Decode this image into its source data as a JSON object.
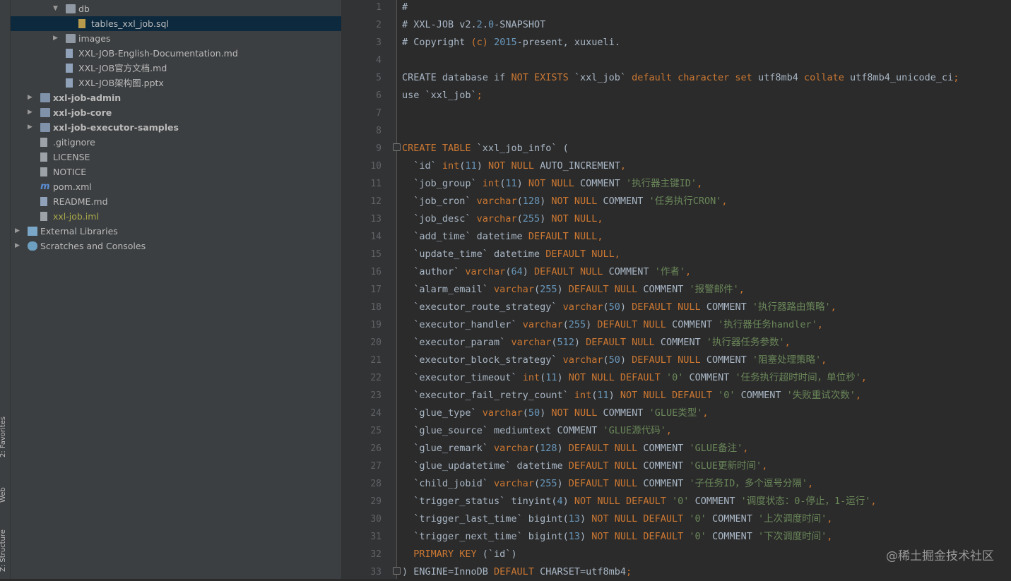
{
  "side_strip": {
    "favorites": "2: Favorites",
    "web": "Web",
    "structure": "Z: Structure"
  },
  "tree": [
    {
      "label": "db",
      "level": 3,
      "arrow": "▼",
      "icon": "folder-icon"
    },
    {
      "label": "tables_xxl_job.sql",
      "level": 4,
      "arrow": "",
      "icon": "sql-file-icon",
      "selected": true
    },
    {
      "label": "images",
      "level": 3,
      "arrow": "▶",
      "icon": "folder-icon"
    },
    {
      "label": "XXL-JOB-English-Documentation.md",
      "level": 3,
      "arrow": "",
      "icon": "markdown-file-icon"
    },
    {
      "label": "XXL-JOB官方文档.md",
      "level": 3,
      "arrow": "",
      "icon": "markdown-file-icon"
    },
    {
      "label": "XXL-JOB架构图.pptx",
      "level": 3,
      "arrow": "",
      "icon": "pptx-file-icon"
    },
    {
      "label": "xxl-job-admin",
      "level": 1,
      "arrow": "▶",
      "icon": "module-folder-icon",
      "bold": true
    },
    {
      "label": "xxl-job-core",
      "level": 1,
      "arrow": "▶",
      "icon": "module-folder-icon",
      "bold": true
    },
    {
      "label": "xxl-job-executor-samples",
      "level": 1,
      "arrow": "▶",
      "icon": "module-folder-icon",
      "bold": true
    },
    {
      "label": ".gitignore",
      "level": 1,
      "arrow": "",
      "icon": "text-file-icon"
    },
    {
      "label": "LICENSE",
      "level": 1,
      "arrow": "",
      "icon": "text-file-icon"
    },
    {
      "label": "NOTICE",
      "level": 1,
      "arrow": "",
      "icon": "text-file-icon"
    },
    {
      "label": "pom.xml",
      "level": 1,
      "arrow": "",
      "icon": "maven-icon"
    },
    {
      "label": "README.md",
      "level": 1,
      "arrow": "",
      "icon": "markdown-file-icon"
    },
    {
      "label": "xxl-job.iml",
      "level": 1,
      "arrow": "",
      "icon": "iml-file-icon",
      "olive": true
    },
    {
      "label": "External Libraries",
      "level": 0,
      "arrow": "▶",
      "icon": "library-icon"
    },
    {
      "label": "Scratches and Consoles",
      "level": 0,
      "arrow": "▶",
      "icon": "scratches-icon"
    }
  ],
  "editor": {
    "line_numbers": [
      "1",
      "2",
      "3",
      "4",
      "5",
      "6",
      "7",
      "8",
      "9",
      "10",
      "11",
      "12",
      "13",
      "14",
      "15",
      "16",
      "17",
      "18",
      "19",
      "20",
      "21",
      "22",
      "23",
      "24",
      "25",
      "26",
      "27",
      "28",
      "29",
      "30",
      "31",
      "32",
      "33"
    ],
    "lines": [
      [
        [
          "cmt",
          "#"
        ]
      ],
      [
        [
          "cmt",
          "# XXL-JOB v2."
        ],
        [
          "num",
          "2"
        ],
        [
          "cmt",
          "."
        ],
        [
          "num",
          "0"
        ],
        [
          "cmt",
          "-SNAPSHOT"
        ]
      ],
      [
        [
          "cmt",
          "# Copyright "
        ],
        [
          "kw",
          "(c)"
        ],
        [
          "cmt",
          " "
        ],
        [
          "num",
          "2015"
        ],
        [
          "cmt",
          "-present, xuxueli."
        ]
      ],
      [],
      [
        [
          "bq",
          "CREATE database if "
        ],
        [
          "kw",
          "NOT EXISTS"
        ],
        [
          "bq",
          " `xxl_job` "
        ],
        [
          "kw",
          "default character set"
        ],
        [
          "bq",
          " utf8mb4 "
        ],
        [
          "kw",
          "collate"
        ],
        [
          "bq",
          " utf8mb4_unicode_ci"
        ],
        [
          "kw",
          ";"
        ]
      ],
      [
        [
          "bq",
          "use `xxl_job`"
        ],
        [
          "kw",
          ";"
        ]
      ],
      [],
      [],
      [
        [
          "kw",
          "CREATE TABLE"
        ],
        [
          "bq",
          " `xxl_job_info` ("
        ]
      ],
      [
        [
          "bq",
          "  `id` "
        ],
        [
          "kw",
          "int"
        ],
        [
          "bq",
          "("
        ],
        [
          "num",
          "11"
        ],
        [
          "bq",
          ") "
        ],
        [
          "kw",
          "NOT NULL"
        ],
        [
          "bq",
          " AUTO_INCREMENT"
        ],
        [
          "kw",
          ","
        ]
      ],
      [
        [
          "bq",
          "  `job_group` "
        ],
        [
          "kw",
          "int"
        ],
        [
          "bq",
          "("
        ],
        [
          "num",
          "11"
        ],
        [
          "bq",
          ") "
        ],
        [
          "kw",
          "NOT NULL"
        ],
        [
          "bq",
          " COMMENT "
        ],
        [
          "str",
          "'执行器主键ID'"
        ],
        [
          "kw",
          ","
        ]
      ],
      [
        [
          "bq",
          "  `job_cron` "
        ],
        [
          "kw",
          "varchar"
        ],
        [
          "bq",
          "("
        ],
        [
          "num",
          "128"
        ],
        [
          "bq",
          ") "
        ],
        [
          "kw",
          "NOT NULL"
        ],
        [
          "bq",
          " COMMENT "
        ],
        [
          "str",
          "'任务执行CRON'"
        ],
        [
          "kw",
          ","
        ]
      ],
      [
        [
          "bq",
          "  `job_desc` "
        ],
        [
          "kw",
          "varchar"
        ],
        [
          "bq",
          "("
        ],
        [
          "num",
          "255"
        ],
        [
          "bq",
          ") "
        ],
        [
          "kw",
          "NOT NULL"
        ],
        [
          "kw",
          ","
        ]
      ],
      [
        [
          "bq",
          "  `add_time` datetime "
        ],
        [
          "kw",
          "DEFAULT NULL"
        ],
        [
          "kw",
          ","
        ]
      ],
      [
        [
          "bq",
          "  `update_time` datetime "
        ],
        [
          "kw",
          "DEFAULT NULL"
        ],
        [
          "kw",
          ","
        ]
      ],
      [
        [
          "bq",
          "  `author` "
        ],
        [
          "kw",
          "varchar"
        ],
        [
          "bq",
          "("
        ],
        [
          "num",
          "64"
        ],
        [
          "bq",
          ") "
        ],
        [
          "kw",
          "DEFAULT NULL"
        ],
        [
          "bq",
          " COMMENT "
        ],
        [
          "str",
          "'作者'"
        ],
        [
          "kw",
          ","
        ]
      ],
      [
        [
          "bq",
          "  `alarm_email` "
        ],
        [
          "kw",
          "varchar"
        ],
        [
          "bq",
          "("
        ],
        [
          "num",
          "255"
        ],
        [
          "bq",
          ") "
        ],
        [
          "kw",
          "DEFAULT NULL"
        ],
        [
          "bq",
          " COMMENT "
        ],
        [
          "str",
          "'报警邮件'"
        ],
        [
          "kw",
          ","
        ]
      ],
      [
        [
          "bq",
          "  `executor_route_strategy` "
        ],
        [
          "kw",
          "varchar"
        ],
        [
          "bq",
          "("
        ],
        [
          "num",
          "50"
        ],
        [
          "bq",
          ") "
        ],
        [
          "kw",
          "DEFAULT NULL"
        ],
        [
          "bq",
          " COMMENT "
        ],
        [
          "str",
          "'执行器路由策略'"
        ],
        [
          "kw",
          ","
        ]
      ],
      [
        [
          "bq",
          "  `executor_handler` "
        ],
        [
          "kw",
          "varchar"
        ],
        [
          "bq",
          "("
        ],
        [
          "num",
          "255"
        ],
        [
          "bq",
          ") "
        ],
        [
          "kw",
          "DEFAULT NULL"
        ],
        [
          "bq",
          " COMMENT "
        ],
        [
          "str",
          "'执行器任务handler'"
        ],
        [
          "kw",
          ","
        ]
      ],
      [
        [
          "bq",
          "  `executor_param` "
        ],
        [
          "kw",
          "varchar"
        ],
        [
          "bq",
          "("
        ],
        [
          "num",
          "512"
        ],
        [
          "bq",
          ") "
        ],
        [
          "kw",
          "DEFAULT NULL"
        ],
        [
          "bq",
          " COMMENT "
        ],
        [
          "str",
          "'执行器任务参数'"
        ],
        [
          "kw",
          ","
        ]
      ],
      [
        [
          "bq",
          "  `executor_block_strategy` "
        ],
        [
          "kw",
          "varchar"
        ],
        [
          "bq",
          "("
        ],
        [
          "num",
          "50"
        ],
        [
          "bq",
          ") "
        ],
        [
          "kw",
          "DEFAULT NULL"
        ],
        [
          "bq",
          " COMMENT "
        ],
        [
          "str",
          "'阻塞处理策略'"
        ],
        [
          "kw",
          ","
        ]
      ],
      [
        [
          "bq",
          "  `executor_timeout` "
        ],
        [
          "kw",
          "int"
        ],
        [
          "bq",
          "("
        ],
        [
          "num",
          "11"
        ],
        [
          "bq",
          ") "
        ],
        [
          "kw",
          "NOT NULL DEFAULT"
        ],
        [
          "bq",
          " "
        ],
        [
          "str",
          "'0'"
        ],
        [
          "bq",
          " COMMENT "
        ],
        [
          "str",
          "'任务执行超时时间，单位秒'"
        ],
        [
          "kw",
          ","
        ]
      ],
      [
        [
          "bq",
          "  `executor_fail_retry_count` "
        ],
        [
          "kw",
          "int"
        ],
        [
          "bq",
          "("
        ],
        [
          "num",
          "11"
        ],
        [
          "bq",
          ") "
        ],
        [
          "kw",
          "NOT NULL DEFAULT"
        ],
        [
          "bq",
          " "
        ],
        [
          "str",
          "'0'"
        ],
        [
          "bq",
          " COMMENT "
        ],
        [
          "str",
          "'失败重试次数'"
        ],
        [
          "kw",
          ","
        ]
      ],
      [
        [
          "bq",
          "  `glue_type` "
        ],
        [
          "kw",
          "varchar"
        ],
        [
          "bq",
          "("
        ],
        [
          "num",
          "50"
        ],
        [
          "bq",
          ") "
        ],
        [
          "kw",
          "NOT NULL"
        ],
        [
          "bq",
          " COMMENT "
        ],
        [
          "str",
          "'GLUE类型'"
        ],
        [
          "kw",
          ","
        ]
      ],
      [
        [
          "bq",
          "  `glue_source` mediumtext COMMENT "
        ],
        [
          "str",
          "'GLUE源代码'"
        ],
        [
          "kw",
          ","
        ]
      ],
      [
        [
          "bq",
          "  `glue_remark` "
        ],
        [
          "kw",
          "varchar"
        ],
        [
          "bq",
          "("
        ],
        [
          "num",
          "128"
        ],
        [
          "bq",
          ") "
        ],
        [
          "kw",
          "DEFAULT NULL"
        ],
        [
          "bq",
          " COMMENT "
        ],
        [
          "str",
          "'GLUE备注'"
        ],
        [
          "kw",
          ","
        ]
      ],
      [
        [
          "bq",
          "  `glue_updatetime` datetime "
        ],
        [
          "kw",
          "DEFAULT NULL"
        ],
        [
          "bq",
          " COMMENT "
        ],
        [
          "str",
          "'GLUE更新时间'"
        ],
        [
          "kw",
          ","
        ]
      ],
      [
        [
          "bq",
          "  `child_jobid` "
        ],
        [
          "kw",
          "varchar"
        ],
        [
          "bq",
          "("
        ],
        [
          "num",
          "255"
        ],
        [
          "bq",
          ") "
        ],
        [
          "kw",
          "DEFAULT NULL"
        ],
        [
          "bq",
          " COMMENT "
        ],
        [
          "str",
          "'子任务ID，多个逗号分隔'"
        ],
        [
          "kw",
          ","
        ]
      ],
      [
        [
          "bq",
          "  `trigger_status` tinyint("
        ],
        [
          "num",
          "4"
        ],
        [
          "bq",
          ") "
        ],
        [
          "kw",
          "NOT NULL DEFAULT"
        ],
        [
          "bq",
          " "
        ],
        [
          "str",
          "'0'"
        ],
        [
          "bq",
          " COMMENT "
        ],
        [
          "str",
          "'调度状态：0-停止，1-运行'"
        ],
        [
          "kw",
          ","
        ]
      ],
      [
        [
          "bq",
          "  `trigger_last_time` bigint("
        ],
        [
          "num",
          "13"
        ],
        [
          "bq",
          ") "
        ],
        [
          "kw",
          "NOT NULL DEFAULT"
        ],
        [
          "bq",
          " "
        ],
        [
          "str",
          "'0'"
        ],
        [
          "bq",
          " COMMENT "
        ],
        [
          "str",
          "'上次调度时间'"
        ],
        [
          "kw",
          ","
        ]
      ],
      [
        [
          "bq",
          "  `trigger_next_time` bigint("
        ],
        [
          "num",
          "13"
        ],
        [
          "bq",
          ") "
        ],
        [
          "kw",
          "NOT NULL DEFAULT"
        ],
        [
          "bq",
          " "
        ],
        [
          "str",
          "'0'"
        ],
        [
          "bq",
          " COMMENT "
        ],
        [
          "str",
          "'下次调度时间'"
        ],
        [
          "kw",
          ","
        ]
      ],
      [
        [
          "kw",
          "  PRIMARY KEY"
        ],
        [
          "bq",
          " (`id`)"
        ]
      ],
      [
        [
          "bq",
          ") ENGINE=InnoDB "
        ],
        [
          "kw",
          "DEFAULT"
        ],
        [
          "bq",
          " CHARSET=utf8mb4"
        ],
        [
          "kw",
          ";"
        ]
      ]
    ]
  },
  "watermark": "@稀土掘金技术社区"
}
